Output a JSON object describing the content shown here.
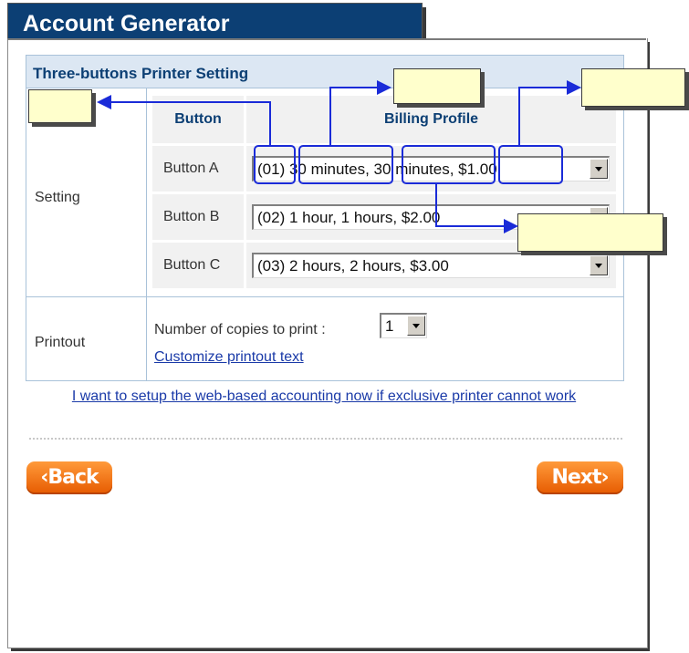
{
  "window": {
    "title": "Account Generator"
  },
  "panel": {
    "title": "Three-buttons Printer Setting",
    "setting_label": "Setting",
    "printout_label": "Printout",
    "table": {
      "col_button": "Button",
      "col_billing": "Billing Profile",
      "rows": [
        {
          "button": "Button A",
          "profile": "(01) 30 minutes, 30 minutes, $1.00"
        },
        {
          "button": "Button B",
          "profile": "(02) 1 hour, 1 hours, $2.00"
        },
        {
          "button": "Button C",
          "profile": "(03) 2 hours, 2 hours, $3.00"
        }
      ]
    },
    "copies_label": "Number of copies to print :",
    "copies_value": "1",
    "customize_link": "Customize printout text"
  },
  "web_accounting_link": "I want to setup the web-based accounting now if exclusive printer cannot work",
  "nav": {
    "back_label": "‹Back",
    "next_label": "Next›"
  },
  "colors": {
    "title_bar": "#0c3f74",
    "panel_header": "#dce7f3",
    "accent_orange": "#f07010",
    "callout_fill": "#ffffcc",
    "highlight_blue": "#1a2bd8"
  }
}
